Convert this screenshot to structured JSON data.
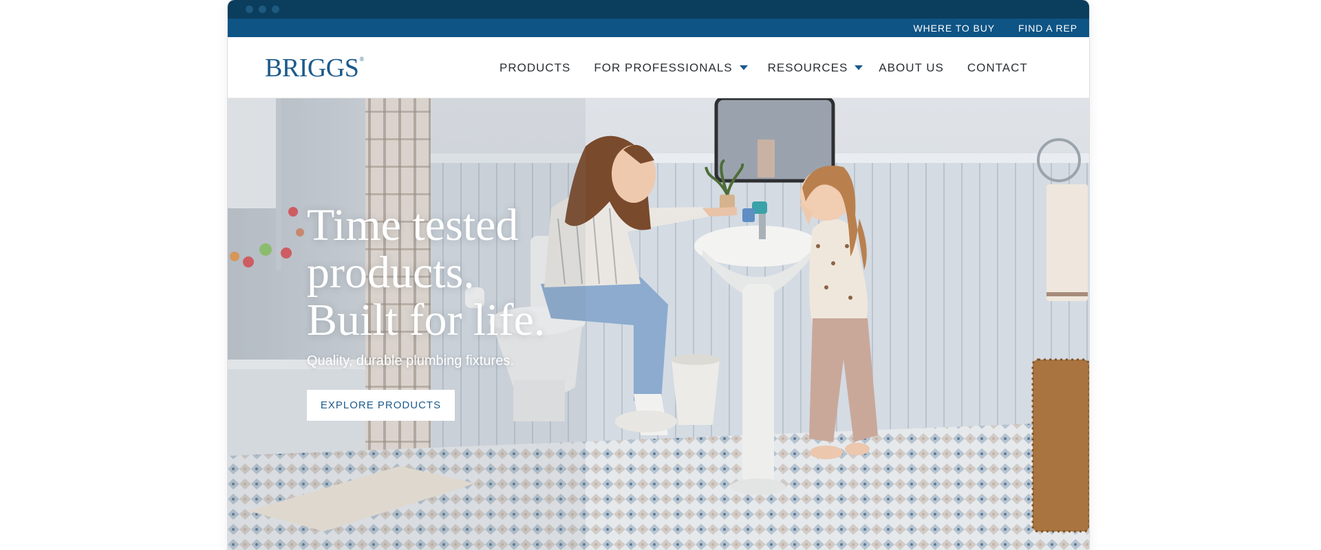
{
  "utility_nav": {
    "where_to_buy": "WHERE TO BUY",
    "find_a_rep": "FIND A REP"
  },
  "brand": {
    "logo_text": "BRIGGS",
    "registered_mark": "®",
    "brand_color": "#1c5a8c"
  },
  "main_nav": {
    "items": [
      {
        "label": "PRODUCTS",
        "has_dropdown": false
      },
      {
        "label": "FOR PROFESSIONALS",
        "has_dropdown": true
      },
      {
        "label": "RESOURCES",
        "has_dropdown": true
      },
      {
        "label": "ABOUT US",
        "has_dropdown": false
      },
      {
        "label": "CONTACT",
        "has_dropdown": false
      }
    ]
  },
  "hero": {
    "headline_lines": [
      "Time tested",
      "products.",
      "Built for life."
    ],
    "subheadline": "Quality, durable plumbing fixtures.",
    "cta_label": "EXPLORE PRODUCTS",
    "image_description_icon": "bathroom-photo"
  },
  "colors": {
    "chrome_bar": "#0b3d5c",
    "utility_bar": "#0e5485",
    "nav_text": "#2b2f33",
    "accent": "#1c5a8c"
  }
}
